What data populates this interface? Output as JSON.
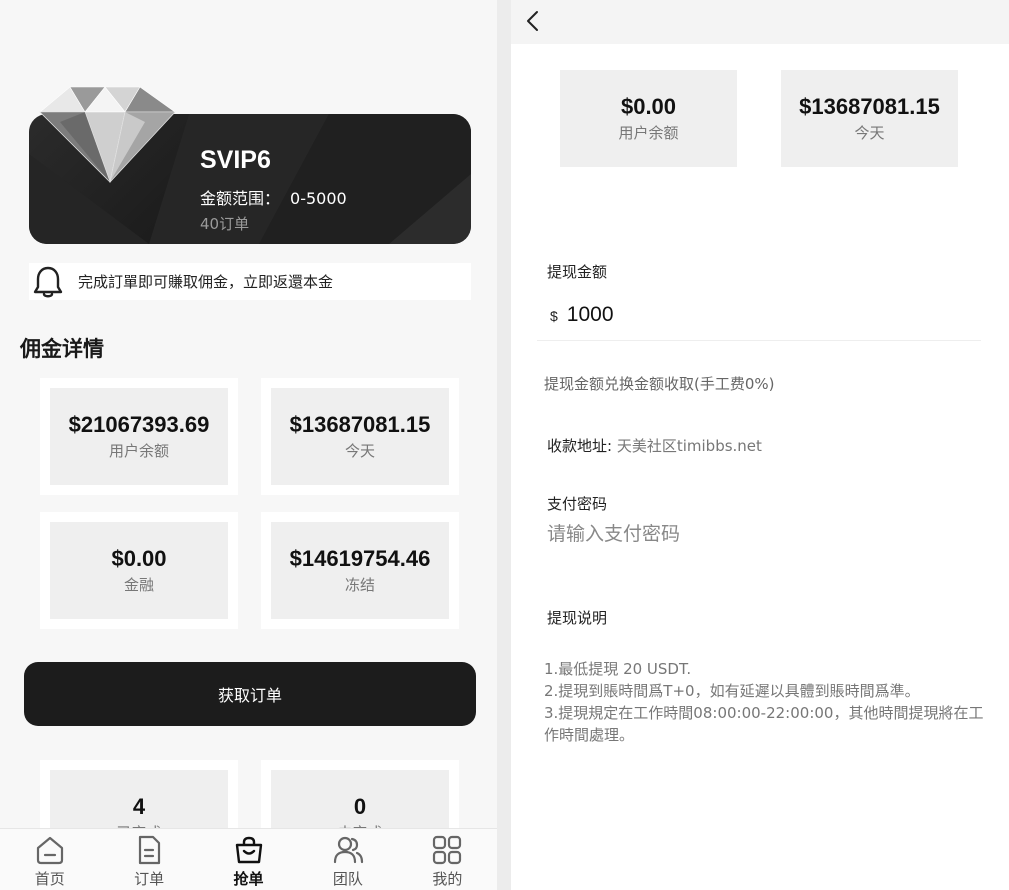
{
  "left": {
    "vip": {
      "name": "SVIP6",
      "range_label": "金额范围：",
      "range_value": "0-5000",
      "orders": "40订单"
    },
    "notice": {
      "text": "完成訂單即可賺取佣金，立即返還本金"
    },
    "section_title": "佣金详情",
    "stats": [
      {
        "value": "$21067393.69",
        "label": "用户余额"
      },
      {
        "value": "$13687081.15",
        "label": "今天"
      },
      {
        "value": "$0.00",
        "label": "金融"
      },
      {
        "value": "$14619754.46",
        "label": "冻结"
      },
      {
        "value": "4",
        "label": "已完成"
      },
      {
        "value": "0",
        "label": "未完成"
      }
    ],
    "get_order_label": "获取订单",
    "tabs": [
      {
        "label": "首页",
        "icon": "home-icon"
      },
      {
        "label": "订单",
        "icon": "document-icon"
      },
      {
        "label": "抢单",
        "icon": "shopping-bag-icon",
        "active": true
      },
      {
        "label": "团队",
        "icon": "team-icon"
      },
      {
        "label": "我的",
        "icon": "grid-icon"
      }
    ]
  },
  "right": {
    "stats": [
      {
        "value": "$0.00",
        "label": "用户余额"
      },
      {
        "value": "$13687081.15",
        "label": "今天"
      }
    ],
    "withdraw_label": "提现金额",
    "currency_symbol": "$",
    "amount_value": "1000",
    "fee_note": "提现金额兑换金额收取(手工费0%)",
    "address_label": "收款地址:",
    "address_value": "天美社区timibbs.net",
    "password_label": "支付密码",
    "password_placeholder": "请输入支付密码",
    "rules_title": "提现说明",
    "rules": [
      "1.最低提現 20 USDT.",
      "2.提現到賬時間爲T+0，如有延遲以具體到賬時間爲準。",
      "3.提現規定在工作時間08:00:00-22:00:00，其他時間提現將在工作時間處理。"
    ]
  }
}
